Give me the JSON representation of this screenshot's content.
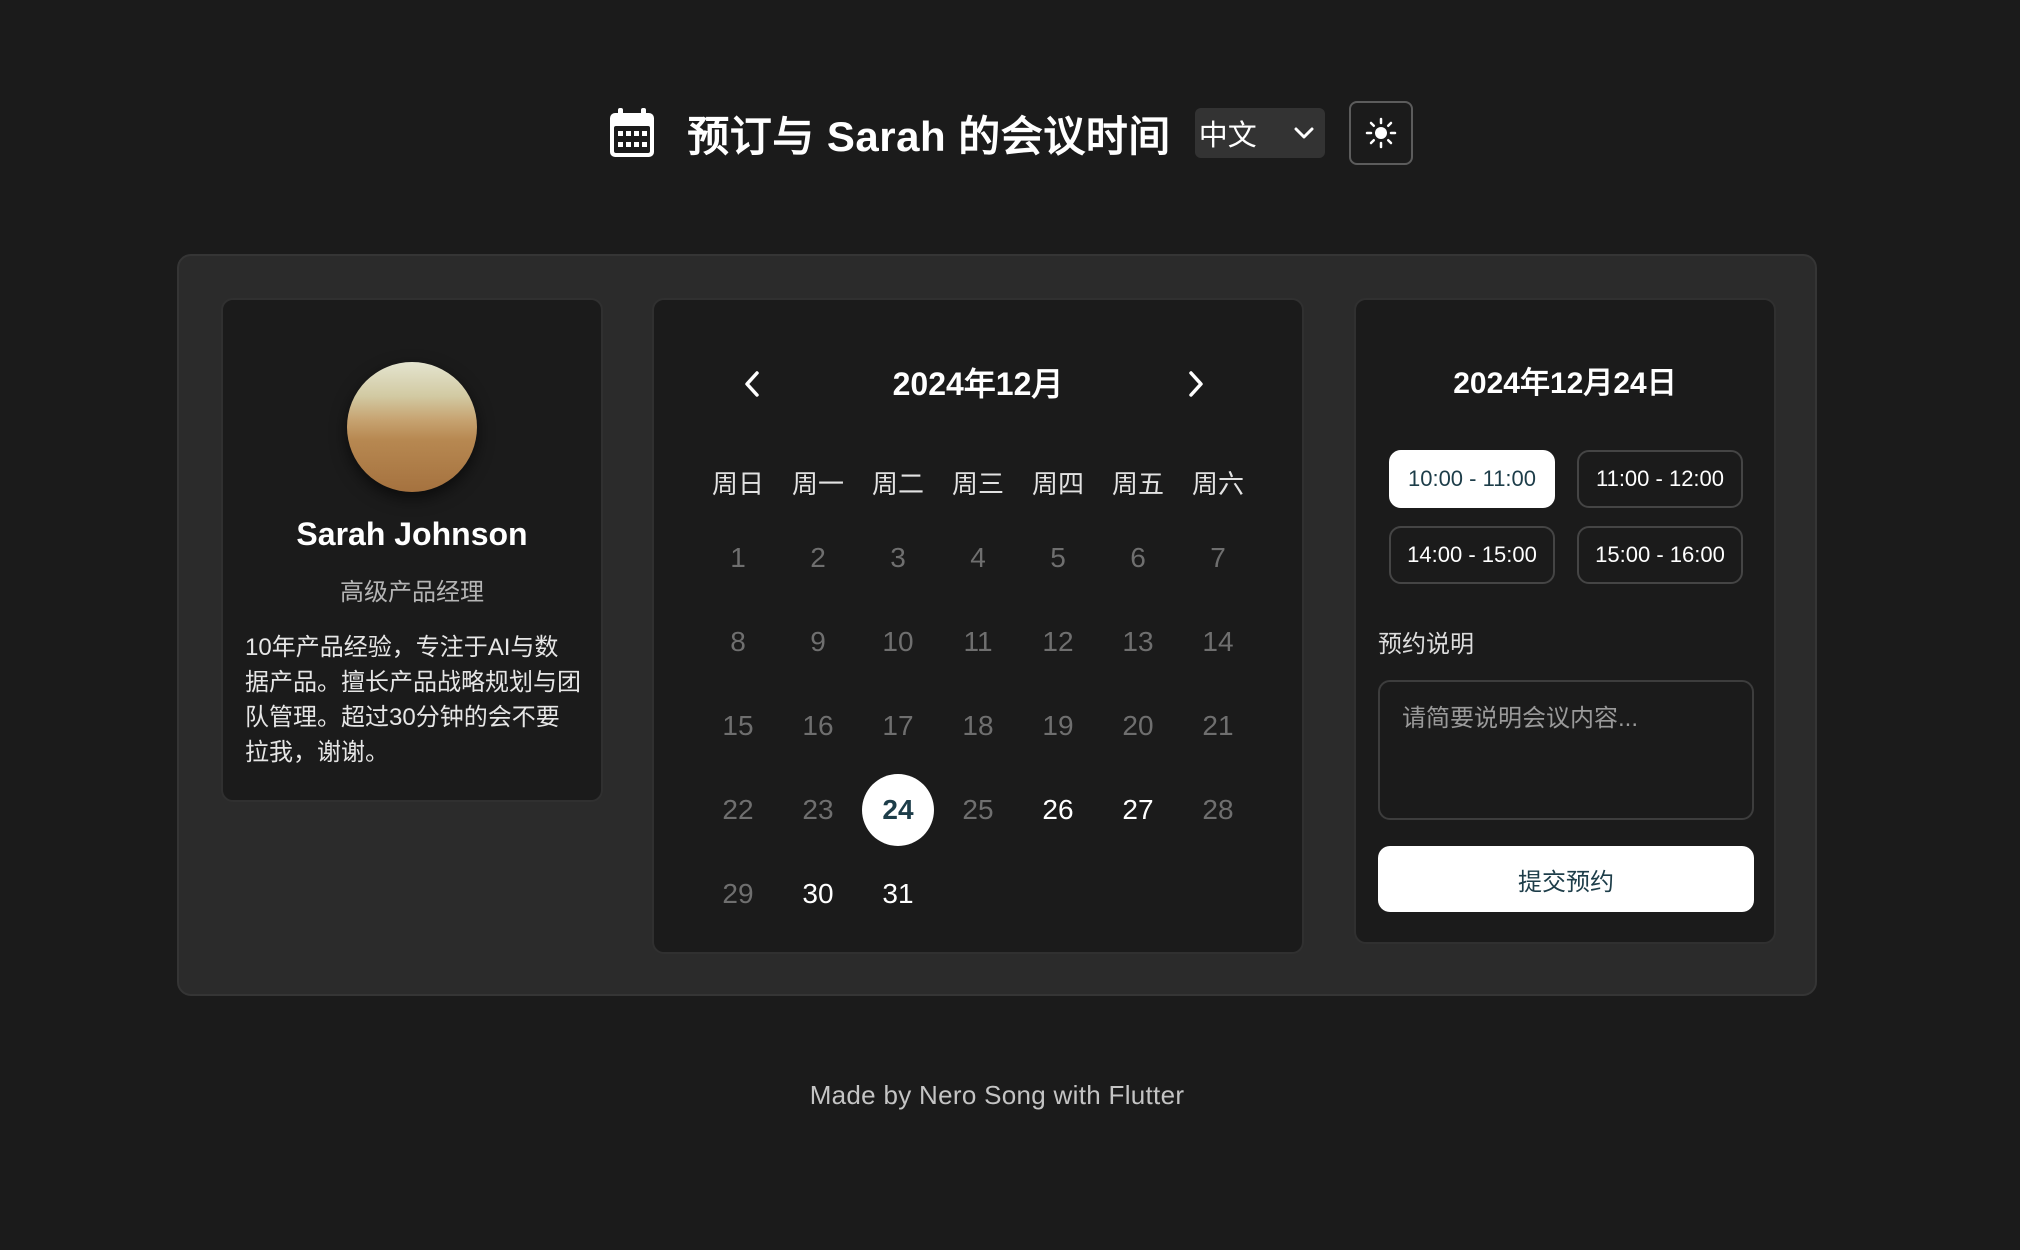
{
  "header": {
    "icon": "calendar-icon",
    "title": "预订与 Sarah 的会议时间",
    "language": "中文",
    "theme_icon": "sun-icon"
  },
  "profile": {
    "name": "Sarah Johnson",
    "role": "高级产品经理",
    "bio": "10年产品经验，专注于AI与数据产品。擅长产品战略规划与团队管理。超过30分钟的会不要拉我，谢谢。"
  },
  "calendar": {
    "month_title": "2024年12月",
    "weekdays": [
      "周日",
      "周一",
      "周二",
      "周三",
      "周四",
      "周五",
      "周六"
    ],
    "days": [
      {
        "n": "1",
        "s": "disabled"
      },
      {
        "n": "2",
        "s": "disabled"
      },
      {
        "n": "3",
        "s": "disabled"
      },
      {
        "n": "4",
        "s": "disabled"
      },
      {
        "n": "5",
        "s": "disabled"
      },
      {
        "n": "6",
        "s": "disabled"
      },
      {
        "n": "7",
        "s": "disabled"
      },
      {
        "n": "8",
        "s": "disabled"
      },
      {
        "n": "9",
        "s": "disabled"
      },
      {
        "n": "10",
        "s": "disabled"
      },
      {
        "n": "11",
        "s": "disabled"
      },
      {
        "n": "12",
        "s": "disabled"
      },
      {
        "n": "13",
        "s": "disabled"
      },
      {
        "n": "14",
        "s": "disabled"
      },
      {
        "n": "15",
        "s": "disabled"
      },
      {
        "n": "16",
        "s": "disabled"
      },
      {
        "n": "17",
        "s": "disabled"
      },
      {
        "n": "18",
        "s": "disabled"
      },
      {
        "n": "19",
        "s": "disabled"
      },
      {
        "n": "20",
        "s": "disabled"
      },
      {
        "n": "21",
        "s": "disabled"
      },
      {
        "n": "22",
        "s": "disabled"
      },
      {
        "n": "23",
        "s": "disabled"
      },
      {
        "n": "24",
        "s": "selected"
      },
      {
        "n": "25",
        "s": "disabled"
      },
      {
        "n": "26",
        "s": "available"
      },
      {
        "n": "27",
        "s": "available"
      },
      {
        "n": "28",
        "s": "disabled"
      },
      {
        "n": "29",
        "s": "disabled"
      },
      {
        "n": "30",
        "s": "available"
      },
      {
        "n": "31",
        "s": "available"
      }
    ]
  },
  "booking": {
    "selected_date": "2024年12月24日",
    "slots": [
      {
        "label": "10:00 - 11:00",
        "active": true
      },
      {
        "label": "11:00 - 12:00",
        "active": false
      },
      {
        "label": "14:00 - 15:00",
        "active": false
      },
      {
        "label": "15:00 - 16:00",
        "active": false
      }
    ],
    "note_label": "预约说明",
    "note_placeholder": "请简要说明会议内容...",
    "submit_label": "提交预约"
  },
  "footer": {
    "text": "Made by Nero Song with Flutter"
  },
  "colors": {
    "background": "#1b1b1b",
    "card": "#2b2b2b",
    "panel": "#1b1b1b",
    "accent_text": "#1d3d49",
    "muted": "#6f6f6f"
  }
}
